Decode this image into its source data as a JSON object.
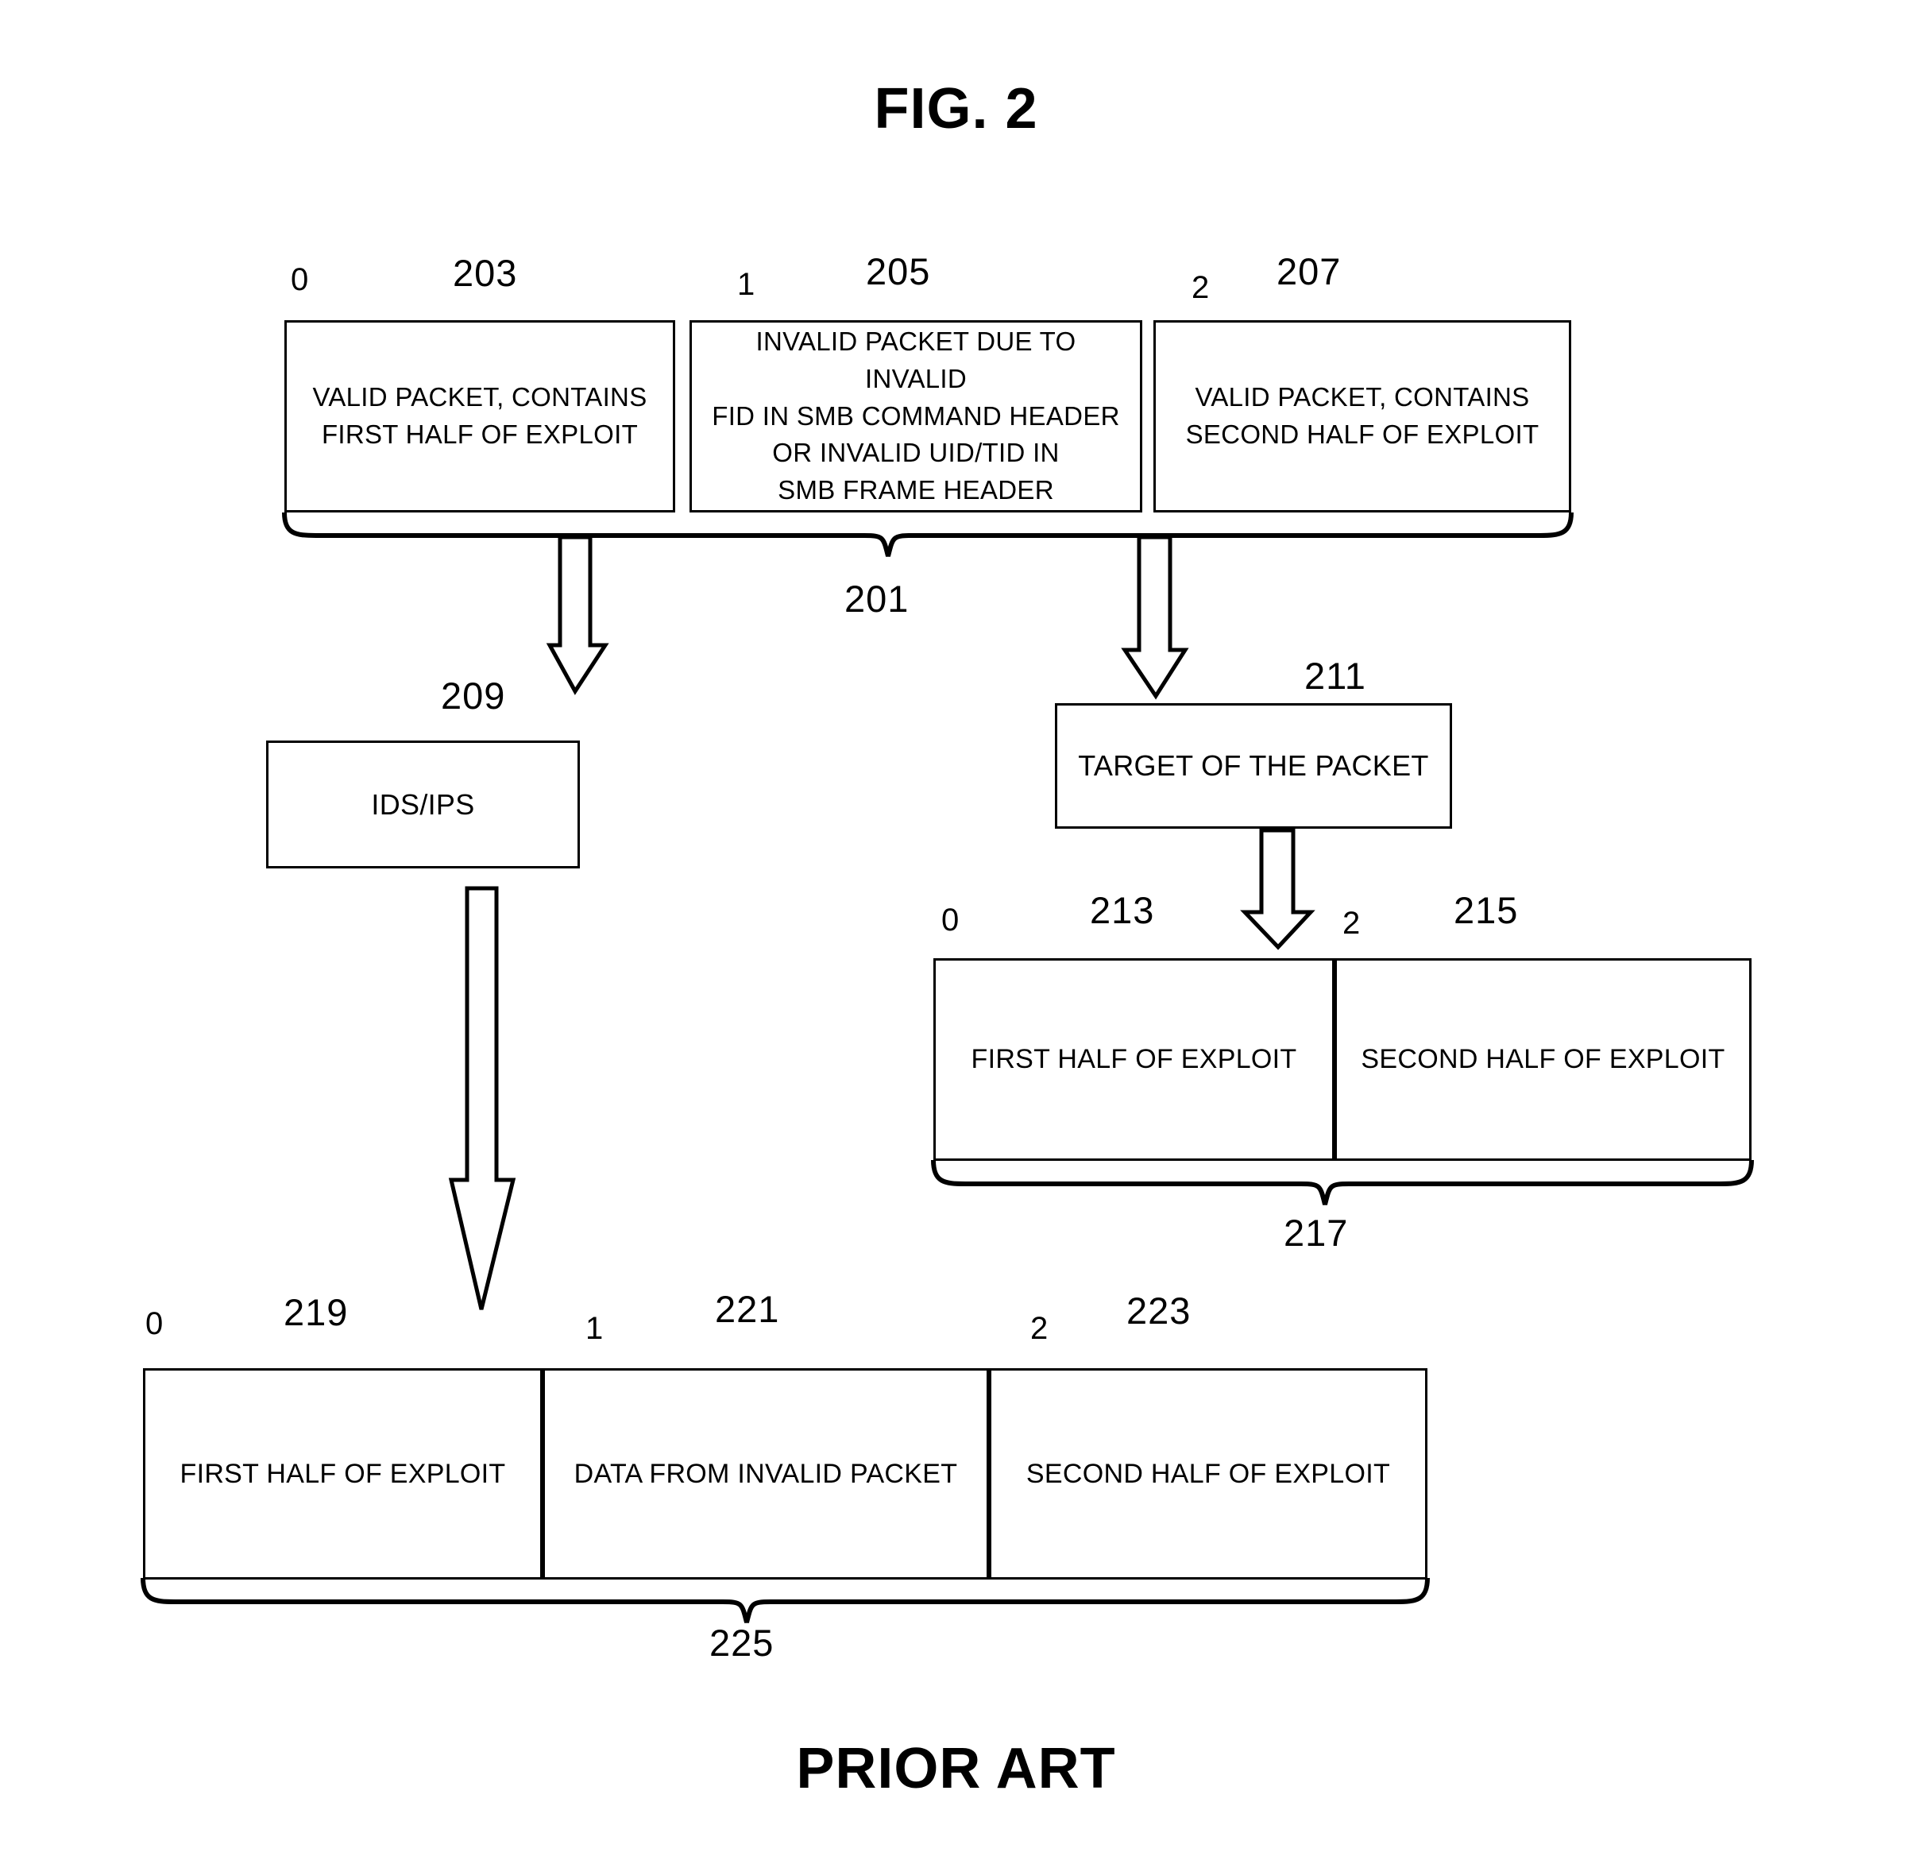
{
  "figure": {
    "title": "FIG. 2",
    "footer": "PRIOR ART"
  },
  "top_row": {
    "brace_label": "201",
    "cells": [
      {
        "index": "0",
        "ref": "203",
        "text": "VALID PACKET, CONTAINS\nFIRST HALF OF EXPLOIT"
      },
      {
        "index": "1",
        "ref": "205",
        "text": "INVALID PACKET DUE TO INVALID\nFID IN SMB COMMAND HEADER\nOR INVALID UID/TID IN\nSMB FRAME HEADER"
      },
      {
        "index": "2",
        "ref": "207",
        "text": "VALID PACKET, CONTAINS\nSECOND HALF OF EXPLOIT"
      }
    ]
  },
  "ids_ips": {
    "ref": "209",
    "text": "IDS/IPS"
  },
  "target": {
    "ref": "211",
    "text": "TARGET OF THE PACKET"
  },
  "target_row": {
    "brace_label": "217",
    "cells": [
      {
        "index": "0",
        "ref": "213",
        "text": "FIRST HALF OF EXPLOIT"
      },
      {
        "index": "2",
        "ref": "215",
        "text": "SECOND HALF OF EXPLOIT"
      }
    ]
  },
  "reassembled_row": {
    "brace_label": "225",
    "cells": [
      {
        "index": "0",
        "ref": "219",
        "text": "FIRST HALF OF EXPLOIT"
      },
      {
        "index": "1",
        "ref": "221",
        "text": "DATA FROM INVALID PACKET"
      },
      {
        "index": "2",
        "ref": "223",
        "text": "SECOND HALF OF EXPLOIT"
      }
    ]
  },
  "colors": {
    "ink": "#000000",
    "paper": "#ffffff"
  }
}
